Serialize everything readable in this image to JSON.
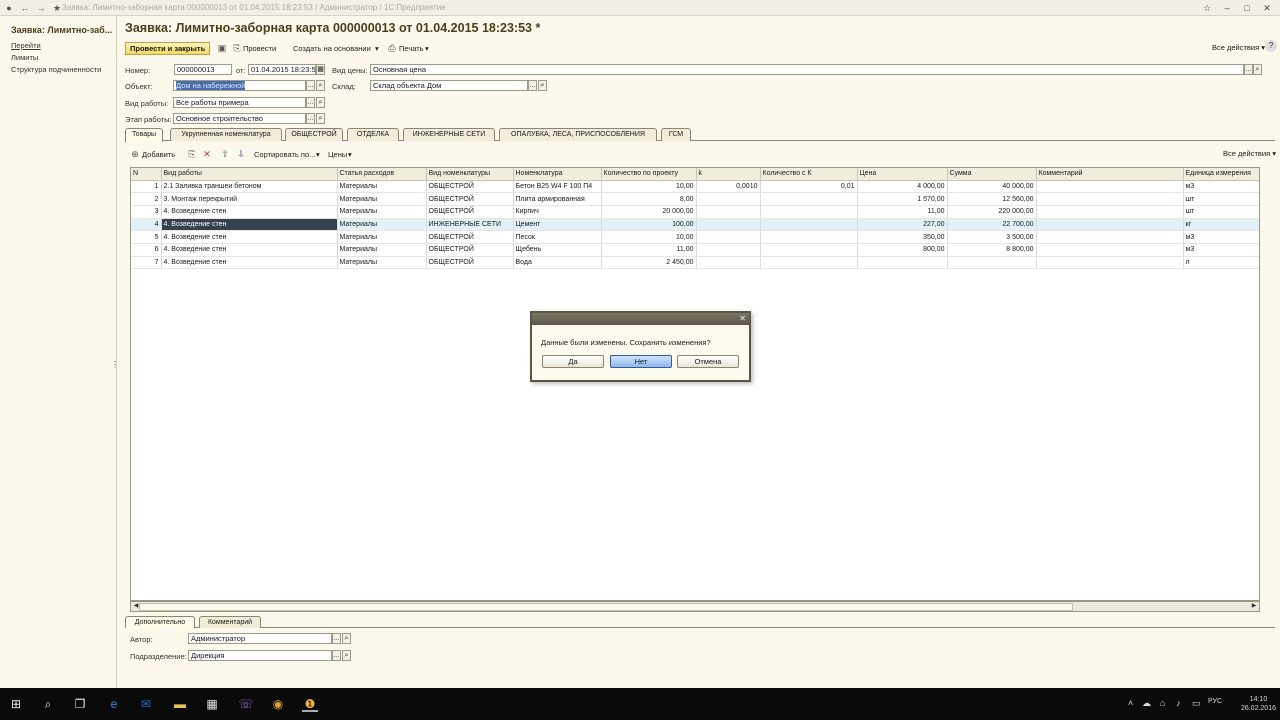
{
  "window": {
    "title": "Заявка: Лимитно-заборная карта 000000013 от 01.04.2015 18:23:53 / Администратор / 1С:Предприятие"
  },
  "left_panel": {
    "title": "Заявка: Лимитно-заб...",
    "items": [
      "Перейти",
      "Лимиты",
      "Структура подчиненности"
    ]
  },
  "document": {
    "title": "Заявка: Лимитно-заборная карта 000000013 от 01.04.2015 18:23:53 *"
  },
  "toolbar": {
    "post_close": "Провести и закрыть",
    "post": "Провести",
    "create_based": "Создать на основании",
    "print": "Печать",
    "all_actions": "Все действия",
    "help": "?"
  },
  "form": {
    "number_label": "Номер:",
    "number": "000000013",
    "from_label": "от:",
    "date": "01.04.2015 18:23:53",
    "price_type_label": "Вид цены:",
    "price_type": "Основная цена",
    "object_label": "Объект:",
    "object": "Дом на набережной",
    "warehouse_label": "Склад:",
    "warehouse": "Склад объекта Дом",
    "work_type_label": "Вид работы:",
    "work_type": "Все работы примера",
    "stage_label": "Этап работы:",
    "stage": "Основное строительство"
  },
  "tabs": [
    "Товары",
    "Укрупненная номенклатура",
    "ОБЩЕСТРОЙ",
    "ОТДЕЛКА",
    "ИНЖЕНЕРНЫЕ СЕТИ",
    "ОПАЛУБКА, ЛЕСА, ПРИСПОСОБЛЕНИЯ",
    "ГСМ"
  ],
  "table_toolbar": {
    "add": "Добавить",
    "sort": "Сортировать по...",
    "prices": "Цены",
    "all_actions": "Все действия"
  },
  "table": {
    "columns": [
      "N",
      "Вид работы",
      "Статья расходов",
      "Вид номенклатуры",
      "Номенклатура",
      "Количество по проекту",
      "k",
      "Количество с К",
      "Цена",
      "Сумма",
      "Комментарий",
      "Единица измерения"
    ],
    "rows": [
      [
        "1",
        "2.1 Заливка траншеи бетоном",
        "Материалы",
        "ОБЩЕСТРОЙ",
        "Бетон  В25 W4 F 100 П4",
        "10,00",
        "0,0010",
        "0,01",
        "4 000,00",
        "40 000,00",
        "",
        "м3"
      ],
      [
        "2",
        "3.  Монтаж перекрытий",
        "Материалы",
        "ОБЩЕСТРОЙ",
        "Плита армированная",
        "8,00",
        "",
        "",
        "1 570,00",
        "12 560,00",
        "",
        "шт"
      ],
      [
        "3",
        "4.  Возведение стен",
        "Материалы",
        "ОБЩЕСТРОЙ",
        "Кирпич",
        "20 000,00",
        "",
        "",
        "11,00",
        "220 000,00",
        "",
        "шт"
      ],
      [
        "4",
        "4.  Возведение стен",
        "Материалы",
        "ИНЖЕНЕРНЫЕ СЕТИ",
        "Цемент",
        "100,00",
        "",
        "",
        "227,00",
        "22 700,00",
        "",
        "кг"
      ],
      [
        "5",
        "4.  Возведение стен",
        "Материалы",
        "ОБЩЕСТРОЙ",
        "Песок",
        "10,00",
        "",
        "",
        "350,00",
        "3 500,00",
        "",
        "м3"
      ],
      [
        "6",
        "4.  Возведение стен",
        "Материалы",
        "ОБЩЕСТРОЙ",
        "Щебень",
        "11,00",
        "",
        "",
        "800,00",
        "8 800,00",
        "",
        "м3"
      ],
      [
        "7",
        "4.  Возведение стен",
        "Материалы",
        "ОБЩЕСТРОЙ",
        "Вода",
        "2 450,00",
        "",
        "",
        "",
        "",
        "",
        "л"
      ]
    ]
  },
  "bottom": {
    "tabs": [
      "Дополнительно",
      "Комментарий"
    ],
    "author_label": "Автор:",
    "author": "Администратор",
    "department_label": "Подразделение:",
    "department": "Дирекция"
  },
  "dialog": {
    "message": "Данные были изменены. Сохранить изменения?",
    "yes": "Да",
    "no": "Нет",
    "cancel": "Отмена"
  },
  "taskbar": {
    "time": "14:10",
    "date": "26.02.2016",
    "lang": "РУС"
  }
}
